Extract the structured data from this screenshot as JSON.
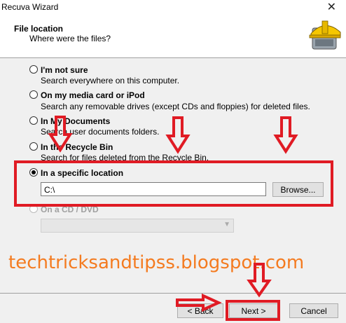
{
  "window": {
    "title": "Recuva Wizard",
    "close_glyph": "✕"
  },
  "header": {
    "title": "File location",
    "subtitle": "Where were the files?",
    "logo_icon": "recuva-hard-hat-logo"
  },
  "options": [
    {
      "label": "I'm not sure",
      "desc": "Search everywhere on this computer.",
      "checked": false,
      "enabled": true
    },
    {
      "label": "On my media card or iPod",
      "desc": "Search any removable drives (except CDs and floppies) for deleted files.",
      "checked": false,
      "enabled": true
    },
    {
      "label": "In My Documents",
      "desc": "Search user documents folders.",
      "checked": false,
      "enabled": true
    },
    {
      "label": "In the Recycle Bin",
      "desc": "Search for files deleted from the Recycle Bin.",
      "checked": false,
      "enabled": true
    },
    {
      "label": "In a specific location",
      "checked": true,
      "enabled": true
    },
    {
      "label": "On a CD / DVD",
      "checked": false,
      "enabled": false
    }
  ],
  "location": {
    "value": "C:\\",
    "browse_label": "Browse..."
  },
  "buttons": {
    "back": "< Back",
    "next": "Next >",
    "cancel": "Cancel"
  },
  "watermark": "techtricksandtipss.blogspot.com",
  "annotation_color": "#e01b24",
  "watermark_color": "#f47b20"
}
